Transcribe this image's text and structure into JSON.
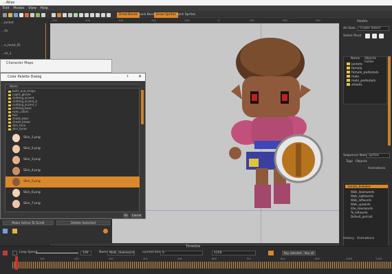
{
  "window": {
    "title": "...Atlas"
  },
  "menu": [
    "Edit",
    "Modes",
    "View",
    "Help"
  ],
  "toolbar": {
    "buttons": [
      {
        "label": "Draw Bones",
        "active": true
      },
      {
        "label": "Lock Bones",
        "active": false
      },
      {
        "label": "Draw Sprites",
        "active": true
      },
      {
        "label": "Lock Sprites",
        "active": false
      }
    ]
  },
  "left_panel": {
    "rows": [
      "...jacket",
      "...ds",
      "...o_head_ID",
      "...sh_1"
    ]
  },
  "character_maps": {
    "title": "Character Maps"
  },
  "color_palette": {
    "title": "Color Palette Dialog",
    "help": "?",
    "close": "✕",
    "header": "Name",
    "folders": [
      "belts_and_straps",
      "capes_gloves",
      "clothing_accent",
      "clothing_accent_b",
      "clothing_accent_c",
      "clothing_base",
      "eyes_colors",
      "hair",
      "shade_base",
      "shade_brows",
      "skin_tone",
      "skin_tones"
    ],
    "skins": [
      {
        "label": "Skin_1.png",
        "color": "#f3d7c0"
      },
      {
        "label": "Skin_2.png",
        "color": "#f0c8a6"
      },
      {
        "label": "Skin_3.png",
        "color": "#e8b08a"
      },
      {
        "label": "Skin_4.png",
        "color": "#cf8f63"
      },
      {
        "label": "Skin_5.png",
        "color": "#8e5a3b",
        "selected": true
      },
      {
        "label": "Skin_6.png",
        "color": "#f2d2b8"
      },
      {
        "label": "Skin_7.png",
        "color": "#eec4a8"
      },
      {
        "label": "Skin_8.png",
        "color": "#e9b8a0"
      },
      {
        "label": "Skin_9.png",
        "color": "#f0c0a8"
      }
    ],
    "ok": "Ok",
    "cancel": "Cancel"
  },
  "left_bottom": {
    "make_active": "Make Active To Scroll",
    "delete_selected": "Delete Selected"
  },
  "ruler_ticks": [
    "-500",
    "-400",
    "-300",
    "-200",
    "-100",
    "0",
    "100",
    "200",
    "300"
  ],
  "right_panel": {
    "header": "Palette",
    "all_label": "All Slots",
    "dropdown": "Create Select",
    "select_label": "Select Pivot",
    "tree_header": [
      "Name",
      "Objects Folder"
    ],
    "tree": [
      "jackets",
      "female",
      "female_pedestals",
      "male",
      "male_pedestals",
      "shields"
    ],
    "anim_label": "Sequence Name",
    "anim_field": "sprites",
    "tabs": [
      "Tags",
      "Objects"
    ],
    "animations_header": "Animations",
    "anim_root": "female_bodybox",
    "animations": [
      "Walk_downwards",
      "Walk_rightwards",
      "Walk_leftwards",
      "Walk_upwards",
      "Idle_downwards",
      "Te_leftwards",
      "Default_portrait"
    ],
    "bottom_tabs": [
      "History",
      "Animations"
    ]
  },
  "timeline": {
    "label": "Timeline",
    "loop_label": "Loop Speed",
    "loop_value": "100",
    "name_label": "Name",
    "anim_name": "Walk_downward",
    "current_time_label": "current time",
    "current_time": "0",
    "total": "1250",
    "key_button": "Key selected",
    "key_all": "Key all",
    "ruler": [
      "100",
      "200",
      "300",
      "400",
      "500",
      "600",
      "700",
      "800",
      "900",
      "1000",
      "1100"
    ]
  }
}
